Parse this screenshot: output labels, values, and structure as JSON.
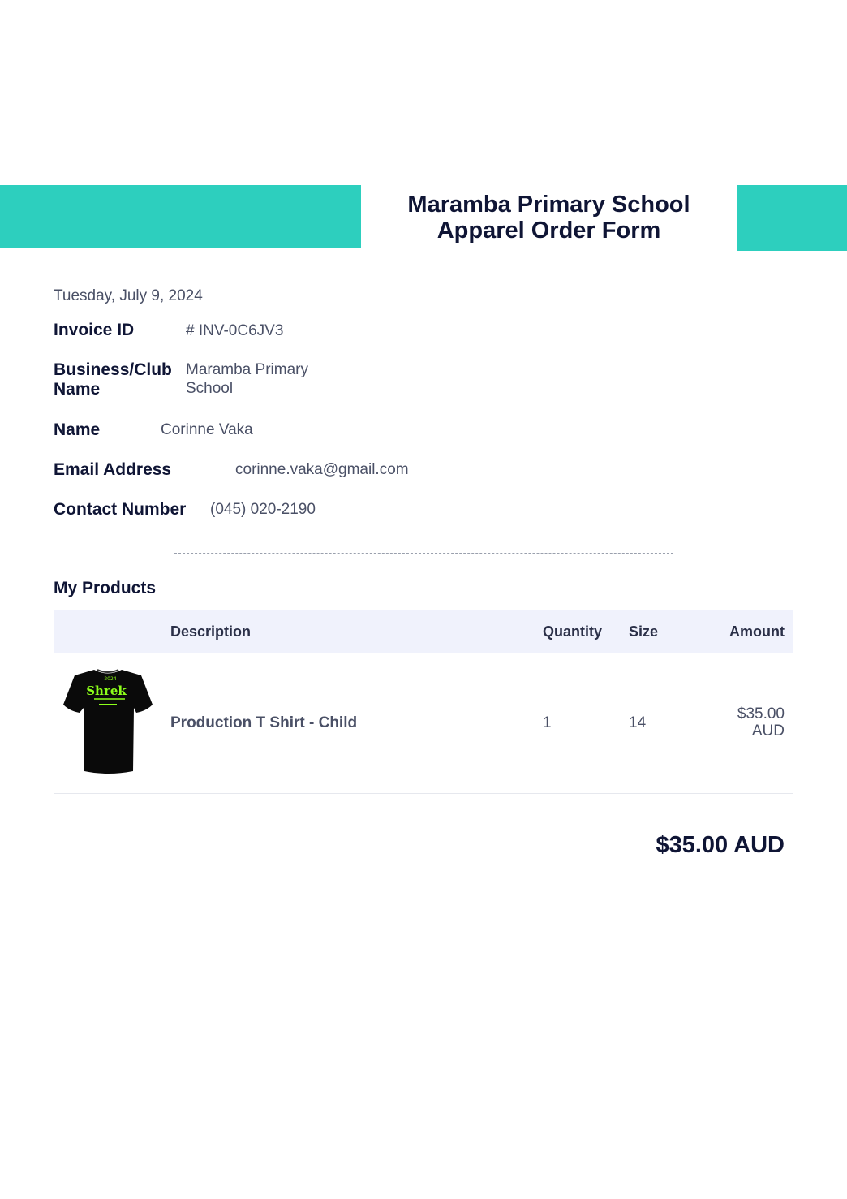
{
  "header": {
    "title": "Maramba Primary School Apparel Order Form",
    "accent_color": "#2dcfbe"
  },
  "date": "Tuesday, July 9, 2024",
  "fields": {
    "invoice_id": {
      "label": "Invoice ID",
      "value": "# INV-0C6JV3"
    },
    "business": {
      "label": "Business/Club Name",
      "value": "Maramba Primary School"
    },
    "name": {
      "label": "Name",
      "value": "Corinne Vaka"
    },
    "email": {
      "label": "Email Address",
      "value": "corinne.vaka@gmail.com"
    },
    "contact": {
      "label": "Contact Number",
      "value": "(045) 020-2190"
    }
  },
  "products": {
    "title": "My Products",
    "columns": {
      "description": "Description",
      "quantity": "Quantity",
      "size": "Size",
      "amount": "Amount"
    },
    "rows": [
      {
        "image_icon": "tshirt-icon",
        "image_logo_text": "Shrek",
        "description": "Production T Shirt - Child",
        "quantity": "1",
        "size": "14",
        "amount": "$35.00 AUD"
      }
    ],
    "total": "$35.00 AUD"
  }
}
